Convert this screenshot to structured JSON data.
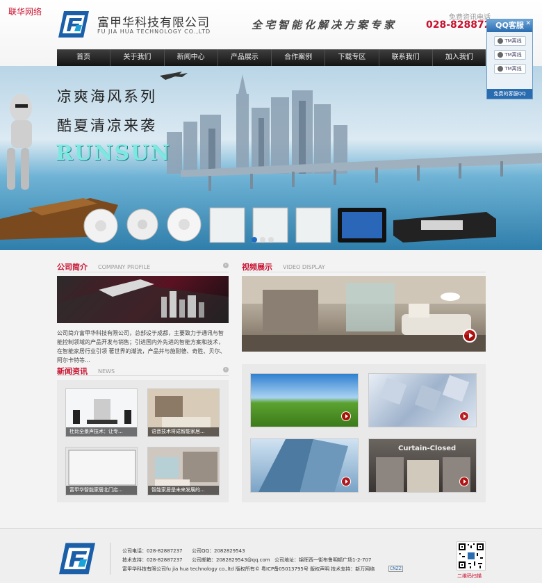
{
  "watermark": "联华网络",
  "header": {
    "brand_cn": "富甲华科技有限公司",
    "brand_en": "FU JIA HUA TECHNOLOGY CO.,LTD",
    "slogan": "全宅智能化解决方案专家",
    "hotline_label": "免费资讯电话",
    "hotline": "028-82887237"
  },
  "nav": {
    "items": [
      "首页",
      "关于我们",
      "新闻中心",
      "产品展示",
      "合作案例",
      "下载专区",
      "联系我们",
      "加入我们"
    ]
  },
  "qq": {
    "title": "QQ客服",
    "buttons": [
      "TM离线",
      "TM离线",
      "TM离线"
    ],
    "footer": "免费的客服QQ"
  },
  "banner": {
    "line1": "凉爽海风系列",
    "line2": "酷夏清凉来袭",
    "brand": "RUNSUN",
    "slide_count": 3,
    "active_slide": 1
  },
  "profile": {
    "title": "公司简介",
    "en": "COMPANY PROFILE",
    "text": "公司简介富甲华科技有限公司，总部设于成都，主要致力于通讯与智能控制领域的产品开发与销售；引进国内外先进的智能方案和技术，在智能家居行业引领 著世界的潮流，产品并与施耐德、奇胜、贝尔、阿尔卡特等..."
  },
  "video": {
    "title": "视频展示",
    "en": "VIDEO DISPLAY"
  },
  "news": {
    "title": "新闻资讯",
    "en": "NEWS",
    "items": [
      "杜比全景声技术：让专...",
      "语音技术将成智能家居...",
      "富甲华智能家居北门店...",
      "智能家居是未来发展的..."
    ]
  },
  "gallery": {
    "items": [
      "",
      "",
      "",
      "Curtain-Closed"
    ]
  },
  "footer": {
    "phone": "公司电话：028-82887237",
    "qq": "公司QQ：2082829543",
    "support": "技术支持：028-82887237",
    "email": "公司邮箱：2082829543@qq.com",
    "address": "公司地址：锦晖西一街布鲁明顿广场1-2-707",
    "copyright": "富甲华科技有限公司fu jia hua technology co.,ltd 版权所有© 粤ICP备05013795号 版权声明 技术支持：新万网络",
    "cnzz": "CNZZ",
    "qr_label": "二维码扫描"
  }
}
